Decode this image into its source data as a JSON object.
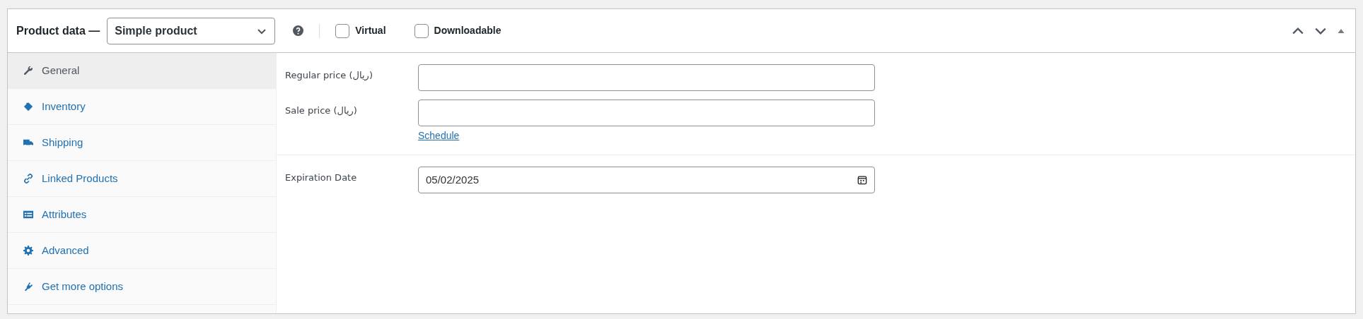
{
  "header": {
    "title": "Product data —",
    "product_type": "Simple product",
    "options": [
      {
        "label": "Virtual",
        "checked": false
      },
      {
        "label": "Downloadable",
        "checked": false
      }
    ]
  },
  "tabs": [
    {
      "label": "General",
      "selected": true
    },
    {
      "label": "Inventory",
      "selected": false
    },
    {
      "label": "Shipping",
      "selected": false
    },
    {
      "label": "Linked Products",
      "selected": false
    },
    {
      "label": "Attributes",
      "selected": false
    },
    {
      "label": "Advanced",
      "selected": false
    },
    {
      "label": "Get more options",
      "selected": false
    }
  ],
  "sections": [
    {
      "fields": [
        {
          "label": "Regular price (ریال)"
        },
        {
          "label": "Sale price (ریال)",
          "link": "Schedule"
        }
      ]
    },
    {
      "fields": [
        {
          "label": "Expiration Date",
          "value": "05/02/2025",
          "kind": "date"
        }
      ]
    }
  ]
}
